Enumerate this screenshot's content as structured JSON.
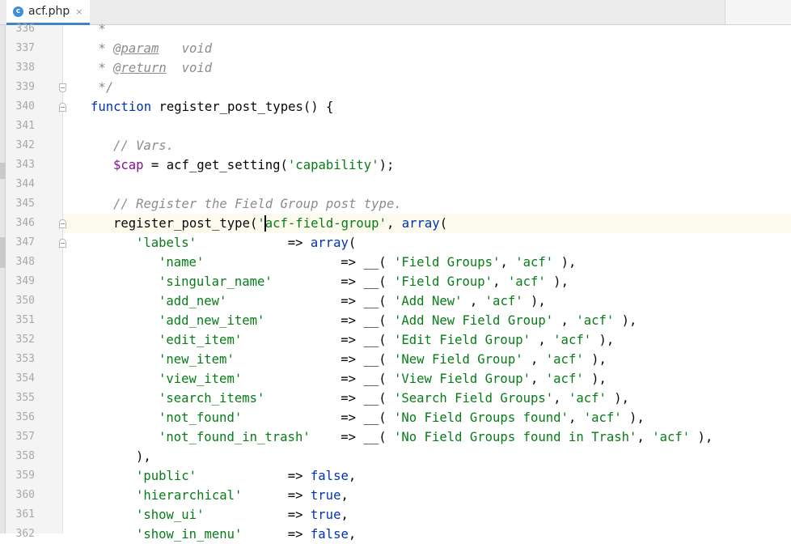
{
  "tab": {
    "icon": "c",
    "title": "acf.php",
    "close": "×"
  },
  "lines": [
    {
      "n": "336",
      "ind": 4,
      "t": [
        [
          "cm",
          "*"
        ]
      ]
    },
    {
      "n": "337",
      "ind": 4,
      "t": [
        [
          "cm",
          "* "
        ],
        [
          "tag",
          "@param"
        ],
        [
          "cm",
          "   void"
        ]
      ]
    },
    {
      "n": "338",
      "ind": 4,
      "t": [
        [
          "cm",
          "* "
        ],
        [
          "tag",
          "@return"
        ],
        [
          "cm",
          "  void"
        ]
      ]
    },
    {
      "n": "339",
      "ind": 4,
      "t": [
        [
          "cm",
          "*/"
        ]
      ]
    },
    {
      "n": "340",
      "ind": 3,
      "t": [
        [
          "kw",
          "function "
        ],
        [
          "",
          "register_post_types() {"
        ]
      ]
    },
    {
      "n": "341",
      "ind": 0,
      "t": []
    },
    {
      "n": "342",
      "ind": 6,
      "t": [
        [
          "cm",
          "// Vars."
        ]
      ]
    },
    {
      "n": "343",
      "ind": 6,
      "t": [
        [
          "var",
          "$cap"
        ],
        [
          "",
          " = acf_get_setting("
        ],
        [
          "str",
          "'capability'"
        ],
        [
          "",
          ");"
        ]
      ]
    },
    {
      "n": "344",
      "ind": 0,
      "t": []
    },
    {
      "n": "345",
      "ind": 6,
      "t": [
        [
          "cm",
          "// Register the Field Group post type."
        ]
      ]
    },
    {
      "n": "346",
      "ind": 6,
      "t": [
        [
          "",
          "register_post_type("
        ],
        [
          "str",
          "'acf-field-group'"
        ],
        [
          ", ",
          ""
        ],
        [
          "kw",
          "array"
        ],
        [
          "",
          "("
        ]
      ]
    },
    {
      "n": "347",
      "ind": 9,
      "t": [
        [
          "str",
          "'labels'"
        ],
        [
          "",
          "            => "
        ],
        [
          "kw",
          "array"
        ],
        [
          "",
          "("
        ]
      ]
    },
    {
      "n": "348",
      "ind": 12,
      "t": [
        [
          "str",
          "'name'"
        ],
        [
          "",
          "                  => __( "
        ],
        [
          "str",
          "'Field Groups'"
        ],
        [
          "",
          ", "
        ],
        [
          "str",
          "'acf'"
        ],
        [
          "",
          " ),"
        ]
      ]
    },
    {
      "n": "349",
      "ind": 12,
      "t": [
        [
          "str",
          "'singular_name'"
        ],
        [
          "",
          "         => __( "
        ],
        [
          "str",
          "'Field Group'"
        ],
        [
          "",
          ", "
        ],
        [
          "str",
          "'acf'"
        ],
        [
          "",
          " ),"
        ]
      ]
    },
    {
      "n": "350",
      "ind": 12,
      "t": [
        [
          "str",
          "'add_new'"
        ],
        [
          "",
          "               => __( "
        ],
        [
          "str",
          "'Add New'"
        ],
        [
          "",
          " , "
        ],
        [
          "str",
          "'acf'"
        ],
        [
          "",
          " ),"
        ]
      ]
    },
    {
      "n": "351",
      "ind": 12,
      "t": [
        [
          "str",
          "'add_new_item'"
        ],
        [
          "",
          "          => __( "
        ],
        [
          "str",
          "'Add New Field Group'"
        ],
        [
          "",
          " , "
        ],
        [
          "str",
          "'acf'"
        ],
        [
          "",
          " ),"
        ]
      ]
    },
    {
      "n": "352",
      "ind": 12,
      "t": [
        [
          "str",
          "'edit_item'"
        ],
        [
          "",
          "             => __( "
        ],
        [
          "str",
          "'Edit Field Group'"
        ],
        [
          "",
          " , "
        ],
        [
          "str",
          "'acf'"
        ],
        [
          "",
          " ),"
        ]
      ]
    },
    {
      "n": "353",
      "ind": 12,
      "t": [
        [
          "str",
          "'new_item'"
        ],
        [
          "",
          "              => __( "
        ],
        [
          "str",
          "'New Field Group'"
        ],
        [
          "",
          " , "
        ],
        [
          "str",
          "'acf'"
        ],
        [
          "",
          " ),"
        ]
      ]
    },
    {
      "n": "354",
      "ind": 12,
      "t": [
        [
          "str",
          "'view_item'"
        ],
        [
          "",
          "             => __( "
        ],
        [
          "str",
          "'View Field Group'"
        ],
        [
          "",
          ", "
        ],
        [
          "str",
          "'acf'"
        ],
        [
          "",
          " ),"
        ]
      ]
    },
    {
      "n": "355",
      "ind": 12,
      "t": [
        [
          "str",
          "'search_items'"
        ],
        [
          "",
          "          => __( "
        ],
        [
          "str",
          "'Search Field Groups'"
        ],
        [
          "",
          ", "
        ],
        [
          "str",
          "'acf'"
        ],
        [
          "",
          " ),"
        ]
      ]
    },
    {
      "n": "356",
      "ind": 12,
      "t": [
        [
          "str",
          "'not_found'"
        ],
        [
          "",
          "             => __( "
        ],
        [
          "str",
          "'No Field Groups found'"
        ],
        [
          "",
          ", "
        ],
        [
          "str",
          "'acf'"
        ],
        [
          "",
          " ),"
        ]
      ]
    },
    {
      "n": "357",
      "ind": 12,
      "t": [
        [
          "str",
          "'not_found_in_trash'"
        ],
        [
          "",
          "    => __( "
        ],
        [
          "str",
          "'No Field Groups found in Trash'"
        ],
        [
          "",
          ", "
        ],
        [
          "str",
          "'acf'"
        ],
        [
          "",
          " ),"
        ]
      ]
    },
    {
      "n": "358",
      "ind": 9,
      "t": [
        [
          "",
          "),"
        ]
      ]
    },
    {
      "n": "359",
      "ind": 9,
      "t": [
        [
          "str",
          "'public'"
        ],
        [
          "",
          "            => "
        ],
        [
          "kw",
          "false"
        ],
        [
          "",
          ","
        ]
      ]
    },
    {
      "n": "360",
      "ind": 9,
      "t": [
        [
          "str",
          "'hierarchical'"
        ],
        [
          "",
          "      => "
        ],
        [
          "kw",
          "true"
        ],
        [
          "",
          ","
        ]
      ]
    },
    {
      "n": "361",
      "ind": 9,
      "t": [
        [
          "str",
          "'show_ui'"
        ],
        [
          "",
          "           => "
        ],
        [
          "kw",
          "true"
        ],
        [
          "",
          ","
        ]
      ]
    },
    {
      "n": "362",
      "ind": 9,
      "t": [
        [
          "str",
          "'show_in_menu'"
        ],
        [
          "",
          "      => "
        ],
        [
          "kw",
          "false"
        ],
        [
          "",
          ","
        ]
      ]
    }
  ],
  "current_line": "346",
  "folds": [
    {
      "n": "339",
      "kind": "end"
    },
    {
      "n": "340",
      "kind": "start"
    },
    {
      "n": "346",
      "kind": "start"
    },
    {
      "n": "347",
      "kind": "start"
    }
  ]
}
